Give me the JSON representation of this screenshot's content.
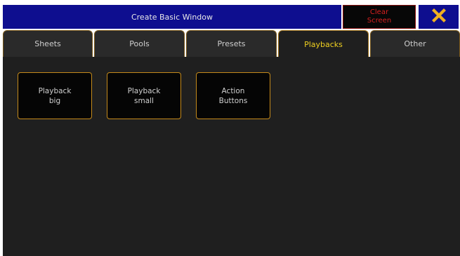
{
  "window": {
    "title": "Create Basic Window",
    "clear_label": "Clear\nScreen",
    "close_icon": "close-x-icon",
    "colors": {
      "title_bg": "#0e0e8f",
      "accent": "#f0d020",
      "tile_border": "#c58a1a",
      "clear_text": "#d82020",
      "close_icon": "#f0b020"
    }
  },
  "tabs": [
    {
      "label": "Sheets",
      "active": false
    },
    {
      "label": "Pools",
      "active": false
    },
    {
      "label": "Presets",
      "active": false
    },
    {
      "label": "Playbacks",
      "active": true
    },
    {
      "label": "Other",
      "active": false
    }
  ],
  "tiles": [
    {
      "label": "Playback\nbig"
    },
    {
      "label": "Playback\nsmall"
    },
    {
      "label": "Action\nButtons"
    }
  ]
}
